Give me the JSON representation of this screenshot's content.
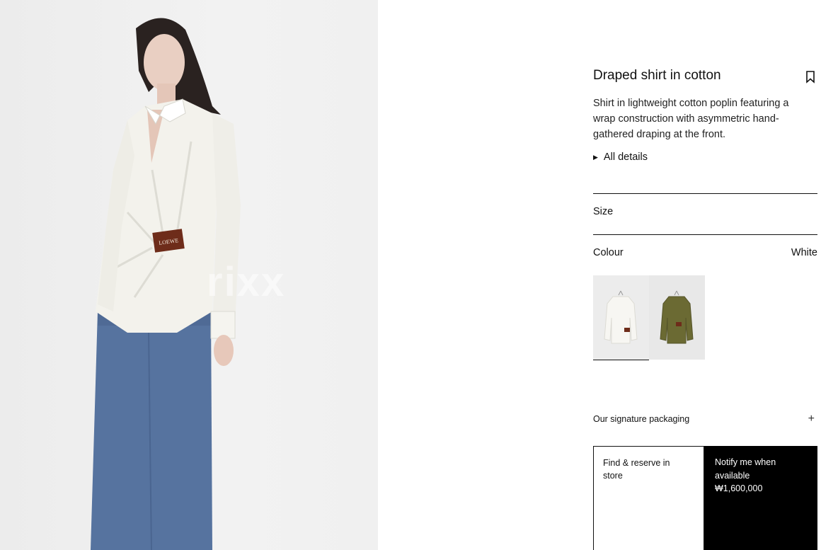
{
  "product": {
    "title": "Draped shirt in cotton",
    "description": "Shirt in lightweight cotton poplin featuring a wrap construction with asymmetric hand-gathered draping at the front.",
    "all_details_label": "All details",
    "brand_label": "LOEWE",
    "watermark": "rixx"
  },
  "size": {
    "label": "Size"
  },
  "colour": {
    "label": "Colour",
    "selected": "White",
    "swatches": [
      {
        "name": "White",
        "color": "#f4f3ef"
      },
      {
        "name": "Olive",
        "color": "#6b6a33"
      }
    ]
  },
  "packaging": {
    "label": "Our signature packaging"
  },
  "actions": {
    "find_label": "Find & reserve in store",
    "notify_label": "Notify me when available",
    "price": "₩1,600,000"
  },
  "colors": {
    "accent": "#000000",
    "brand_tag": "#6e2c1a",
    "denim": "#4f6f9e"
  }
}
